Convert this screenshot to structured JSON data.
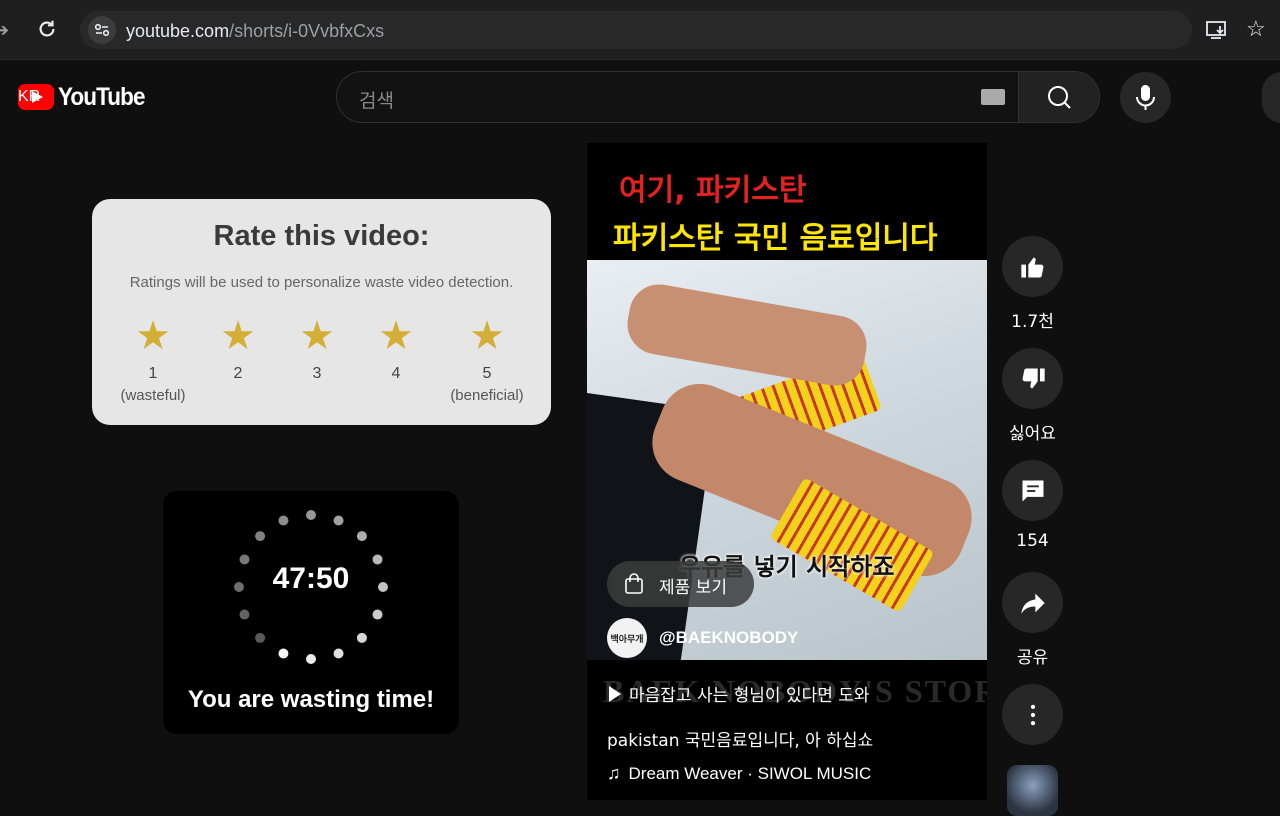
{
  "browser": {
    "url_host": "youtube.com",
    "url_path": "/shorts/i-0VvbfxCxs",
    "icons": [
      "back-icon",
      "reload-icon",
      "site-settings-icon",
      "install-app-icon",
      "bookmark-star-icon"
    ]
  },
  "masthead": {
    "logo_text": "YouTube",
    "region": "KR",
    "search_placeholder": "검색"
  },
  "rating": {
    "title": "Rate this video:",
    "subtitle": "Ratings will be used to personalize waste video detection.",
    "options": [
      {
        "number": "1",
        "desc": "(wasteful)"
      },
      {
        "number": "2",
        "desc": ""
      },
      {
        "number": "3",
        "desc": ""
      },
      {
        "number": "4",
        "desc": ""
      },
      {
        "number": "5",
        "desc": "(beneficial)"
      }
    ],
    "star_color": "#d4af37"
  },
  "timer": {
    "time": "47:50",
    "message": "You are wasting time!"
  },
  "short": {
    "caption_line1": "여기, 파키스탄",
    "caption_line2": "파키스탄 국민 음료입니다",
    "video_subtitle": "우유를 넣기 시작하죠",
    "product_button": "제품 보기",
    "channel_avatar": "백아무개",
    "channel_handle": "@BAEKNOBODY",
    "watermark": "BAEK NOBODY'S STORY",
    "related_video": "마음잡고 사는 형님이 있다면 도와",
    "description": "pakistan 국민음료입니다, 아 하십쇼",
    "music": "Dream Weaver · SIWOL MUSIC"
  },
  "actions": {
    "like_count": "1.7천",
    "dislike_label": "싫어요",
    "comment_count": "154",
    "share_label": "공유"
  },
  "colors": {
    "brand_red": "#ff0000",
    "caption_red": "#e52222",
    "caption_yellow": "#ffe600"
  }
}
